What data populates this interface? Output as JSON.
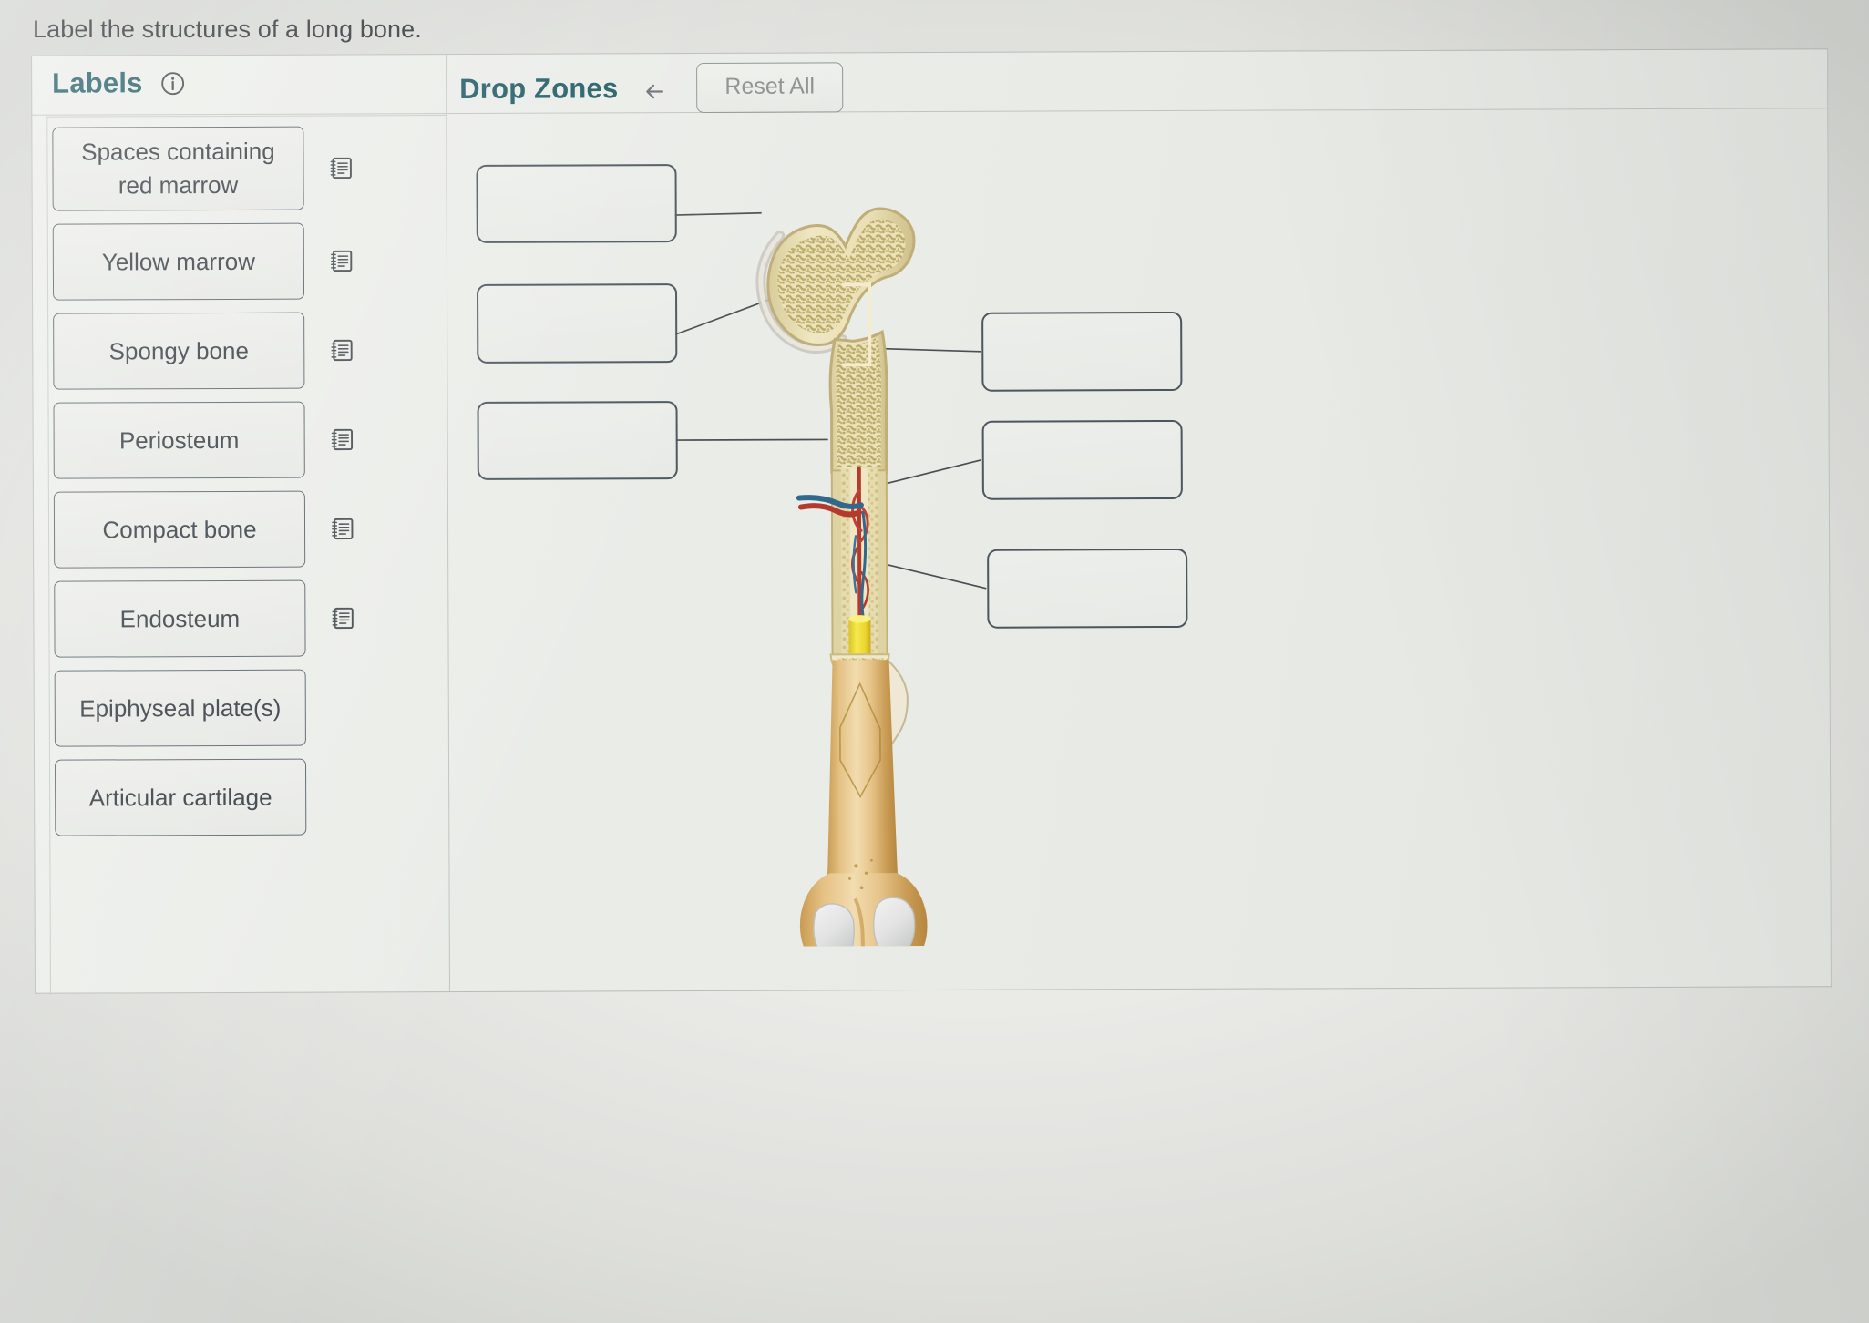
{
  "prompt": "Label the structures of a long bone.",
  "labels_panel": {
    "title": "Labels",
    "info_icon": "info-circle-icon",
    "items": [
      {
        "text": "Spaces containing red marrow",
        "icon": "notes-icon"
      },
      {
        "text": "Yellow marrow",
        "icon": "notes-icon"
      },
      {
        "text": "Spongy bone",
        "icon": "notes-icon"
      },
      {
        "text": "Periosteum",
        "icon": "notes-icon"
      },
      {
        "text": "Compact bone",
        "icon": "notes-icon"
      },
      {
        "text": "Endosteum",
        "icon": "notes-icon"
      },
      {
        "text": "Epiphyseal plate(s)",
        "icon": "notes-icon"
      },
      {
        "text": "Articular cartilage",
        "icon": "notes-icon"
      }
    ]
  },
  "dropzones_panel": {
    "title": "Drop Zones",
    "undo_icon": "undo-arrow-icon",
    "reset_label": "Reset All",
    "zones": [
      {
        "id": "zone-left-1",
        "value": ""
      },
      {
        "id": "zone-left-2",
        "value": ""
      },
      {
        "id": "zone-left-3",
        "value": ""
      },
      {
        "id": "zone-right-1",
        "value": ""
      },
      {
        "id": "zone-right-2",
        "value": ""
      },
      {
        "id": "zone-right-3",
        "value": ""
      }
    ]
  },
  "figure": {
    "name": "long-bone-femur-cutaway",
    "colors": {
      "accent": "#1f5a63",
      "chip_border": "#566169",
      "zone_border": "#4b565d",
      "bone_cortex": "#e8dfb8",
      "bone_shaft": "#e0b872",
      "spongy": "#c8bd86",
      "marrow_yellow": "#f2df3d",
      "artery_red": "#c0392b",
      "vein_blue": "#31688e",
      "cartilage_white": "#e3e4e3"
    }
  }
}
